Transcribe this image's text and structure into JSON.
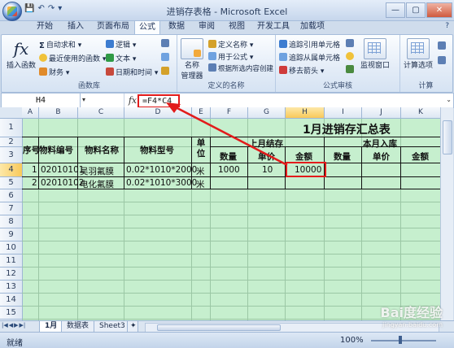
{
  "window": {
    "title": "进销存表格 - Microsoft Excel",
    "min": "—",
    "max": "▢",
    "close": "✕"
  },
  "qat": {
    "save": "💾",
    "undo": "↶",
    "redo": "↷",
    "more": "▾"
  },
  "ribbon": {
    "tabs": [
      "开始",
      "插入",
      "页面布局",
      "公式",
      "数据",
      "审阅",
      "视图",
      "开发工具",
      "加载项"
    ],
    "active_tab": "公式",
    "help": "?",
    "groups": {
      "function_library": {
        "label": "函数库",
        "insert_function": "插入函数",
        "autosum": "自动求和",
        "recent": "最近使用的函数",
        "financial": "财务",
        "logical": "逻辑",
        "text": "文本",
        "datetime": "日期和时间"
      },
      "defined_names": {
        "label": "定义的名称",
        "name_manager": "名称\n管理器",
        "define_name": "定义名称",
        "use_in_formula": "用于公式",
        "create_from_selection": "根据所选内容创建"
      },
      "formula_auditing": {
        "label": "公式审核",
        "trace_precedents": "追踪引用单元格",
        "trace_dependents": "追踪从属单元格",
        "remove_arrows": "移去箭头",
        "watch_window": "监视窗口"
      },
      "calculation": {
        "label": "计算",
        "calc_options": "计算选项"
      }
    }
  },
  "formula_bar": {
    "name_box": "H4",
    "fx": "fx",
    "formula": "=F4*C4"
  },
  "columns": [
    "A",
    "B",
    "C",
    "D",
    "E",
    "F",
    "G",
    "H",
    "I",
    "J",
    "K"
  ],
  "selected_column": "H",
  "rows": [
    "1",
    "2",
    "3",
    "4",
    "5",
    "6",
    "7",
    "8",
    "9",
    "10",
    "11",
    "12",
    "13",
    "14",
    "15",
    "16",
    "17"
  ],
  "selected_row": "4",
  "table": {
    "title": "1月进销存汇总表",
    "headers": {
      "seq": "序号",
      "code": "物料编号",
      "name": "物料名称",
      "model": "物料型号",
      "unit": "单位",
      "last_month": "上月结存",
      "this_month_in": "本月入库",
      "qty": "数量",
      "price": "单价",
      "amount": "金额"
    },
    "rows": [
      {
        "seq": "1",
        "code": "02010101",
        "name": "吴羽氟膜",
        "model": "0.02*1010*2000",
        "unit": "米",
        "qty": "1000",
        "price": "10",
        "amount": "10000"
      },
      {
        "seq": "2",
        "code": "02010102",
        "name": "电化氟膜",
        "model": "0.02*1010*3000",
        "unit": "米",
        "qty": "",
        "price": "",
        "amount": ""
      }
    ]
  },
  "sheet_tabs": [
    "1月",
    "数据表",
    "Sheet3"
  ],
  "active_sheet": "1月",
  "status": {
    "ready": "就绪",
    "zoom": "100%"
  },
  "watermark": {
    "main": "Bai度经验",
    "sub": "jingyan.baidu.com"
  }
}
